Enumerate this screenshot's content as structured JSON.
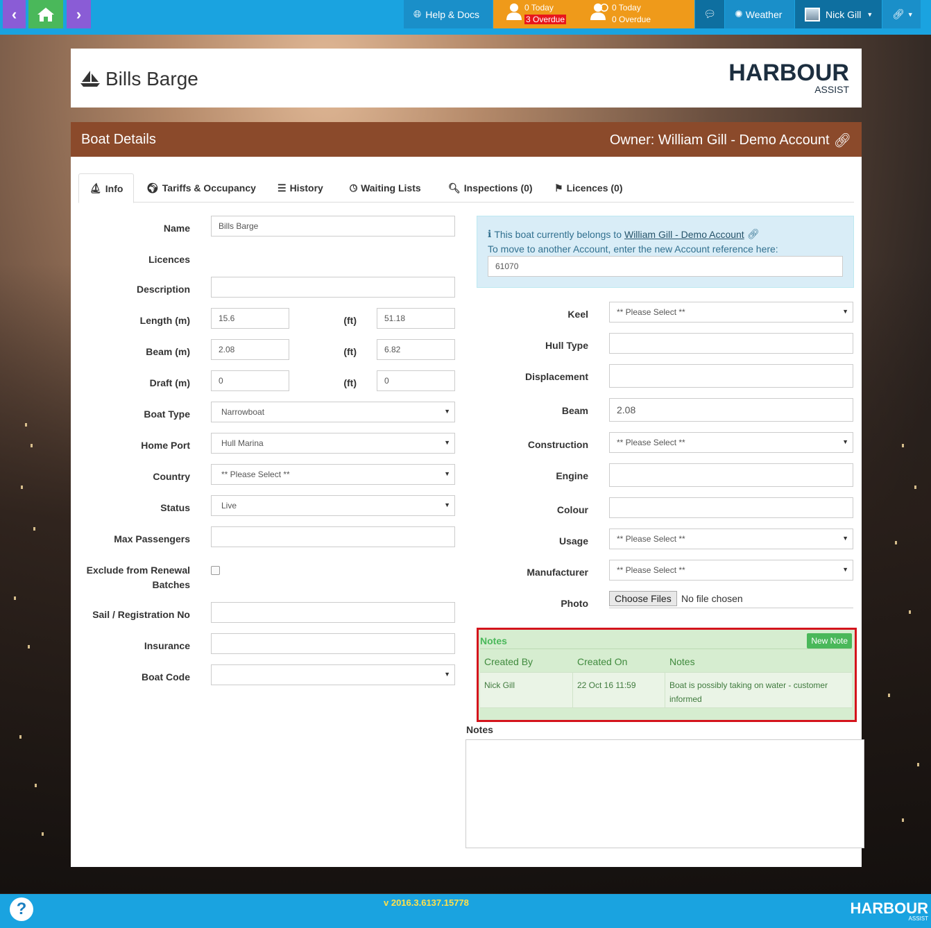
{
  "topbar": {
    "help_label": "Help & Docs",
    "tasks_mine": {
      "today": "0 Today",
      "overdue": "3 Overdue"
    },
    "tasks_team": {
      "today": "0 Today",
      "overdue": "0 Overdue"
    },
    "weather_label": "Weather",
    "user_name": "Nick Gill"
  },
  "header": {
    "title": "Bills Barge",
    "logo_main": "HARBOUR",
    "logo_sub": "ASSIST"
  },
  "panel": {
    "title": "Boat Details",
    "owner": "Owner: William Gill - Demo Account"
  },
  "tabs": [
    {
      "label": "Info"
    },
    {
      "label": "Tariffs & Occupancy"
    },
    {
      "label": "History"
    },
    {
      "label": "Waiting Lists"
    },
    {
      "label": "Inspections (0)"
    },
    {
      "label": "Licences (0)"
    }
  ],
  "left_form": {
    "name_label": "Name",
    "name_value": "Bills Barge",
    "licences_label": "Licences",
    "description_label": "Description",
    "description_value": "",
    "length_label": "Length (m)",
    "length_m": "15.6",
    "length_ft_label": "(ft)",
    "length_ft": "51.18",
    "beam_label": "Beam (m)",
    "beam_m": "2.08",
    "beam_ft_label": "(ft)",
    "beam_ft": "6.82",
    "draft_label": "Draft (m)",
    "draft_m": "0",
    "draft_ft_label": "(ft)",
    "draft_ft": "0",
    "boat_type_label": "Boat Type",
    "boat_type_value": "Narrowboat",
    "home_port_label": "Home Port",
    "home_port_value": "Hull Marina",
    "country_label": "Country",
    "country_value": "** Please Select **",
    "status_label": "Status",
    "status_value": "Live",
    "max_passengers_label": "Max Passengers",
    "max_passengers_value": "",
    "exclude_label_1": "Exclude from Renewal",
    "exclude_label_2": "Batches",
    "sail_label": "Sail / Registration No",
    "sail_value": "",
    "insurance_label": "Insurance",
    "insurance_value": "",
    "boat_code_label": "Boat Code",
    "boat_code_value": ""
  },
  "info_box": {
    "line1_prefix": "This boat currently belongs to",
    "line1_link": "William Gill - Demo Account",
    "line2": "To move to another Account, enter the new Account reference here:",
    "account_ref": "61070"
  },
  "right_form": {
    "keel_label": "Keel",
    "keel_value": "** Please Select **",
    "hull_label": "Hull Type",
    "hull_value": "",
    "displacement_label": "Displacement",
    "displacement_value": "",
    "beam_label": "Beam",
    "beam_value": "2.08",
    "construction_label": "Construction",
    "construction_value": "** Please Select **",
    "engine_label": "Engine",
    "engine_value": "",
    "colour_label": "Colour",
    "colour_value": "",
    "usage_label": "Usage",
    "usage_value": "** Please Select **",
    "manufacturer_label": "Manufacturer",
    "manufacturer_value": "** Please Select **",
    "photo_label": "Photo",
    "choose_files": "Choose Files",
    "no_file": "No file chosen"
  },
  "notes_widget": {
    "title": "Notes",
    "new_note": "New Note",
    "columns": [
      "Created By",
      "Created On",
      "Notes"
    ],
    "rows": [
      {
        "created_by": "Nick Gill",
        "created_on": "22 Oct 16 11:59",
        "note_1": "Boat is possibly taking on water - customer",
        "note_2": "informed"
      }
    ]
  },
  "notes_field": {
    "label": "Notes",
    "value": ""
  },
  "footer": {
    "version": "v 2016.3.6137.15778",
    "help_glyph": "?",
    "logo_main": "HARBOUR",
    "logo_sub": "ASSIST"
  },
  "colors": {
    "topbar": "#1aa3e0",
    "panel_head": "#8b4a2b",
    "tasks": "#ef9a1a",
    "nav_purple": "#8a5cd6",
    "nav_green": "#4ab85a",
    "highlight_red": "#d4141c"
  }
}
